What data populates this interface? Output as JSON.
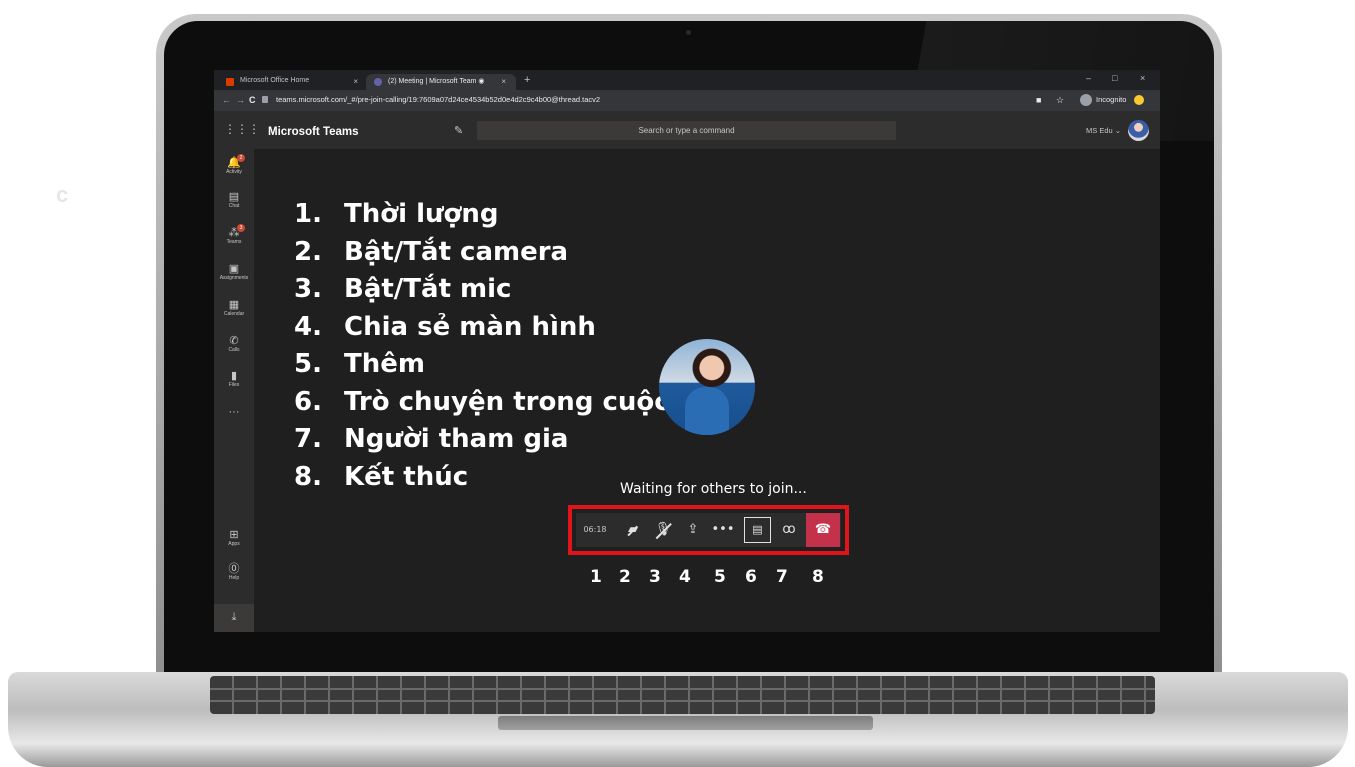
{
  "stray_letter": "c",
  "browser": {
    "tabs": [
      {
        "title": "Microsoft Office Home",
        "close": "×"
      },
      {
        "title": "(2) Meeting | Microsoft Team ◉",
        "close": "×"
      }
    ],
    "new_tab": "+",
    "window_controls": {
      "minimize": "–",
      "maximize": "□",
      "close": "×"
    },
    "nav": {
      "back": "←",
      "forward": "→",
      "reload": "C"
    },
    "url": "teams.microsoft.com/_#/pre-join-calling/19:7609a07d24ce4534b52d0e4d2c9c4b00@thread.tacv2",
    "incognito_label": "Incognito",
    "star": "☆",
    "camera_glyph": "■"
  },
  "teams": {
    "app_launcher": "⋮⋮⋮",
    "title": "Microsoft Teams",
    "compose_icon": "✎",
    "search_placeholder": "Search or type a command",
    "user_label": "MS Edu ⌄",
    "rail": [
      {
        "label": "Activity",
        "icon": "bell-icon",
        "glyph": "🔔",
        "badge": "2"
      },
      {
        "label": "Chat",
        "icon": "chat-icon",
        "glyph": "▤",
        "badge": ""
      },
      {
        "label": "Teams",
        "icon": "teams-icon",
        "glyph": "⁂",
        "badge": "3"
      },
      {
        "label": "Assignments",
        "icon": "assignments-icon",
        "glyph": "▣",
        "badge": ""
      },
      {
        "label": "Calendar",
        "icon": "calendar-icon",
        "glyph": "▦",
        "badge": ""
      },
      {
        "label": "Calls",
        "icon": "phone-icon",
        "glyph": "✆",
        "badge": ""
      },
      {
        "label": "Files",
        "icon": "files-icon",
        "glyph": "▮",
        "badge": ""
      },
      {
        "label": "",
        "icon": "more-icon",
        "glyph": "···",
        "badge": ""
      },
      {
        "label": "Apps",
        "icon": "apps-icon",
        "glyph": "⊞",
        "badge": ""
      },
      {
        "label": "Help",
        "icon": "help-icon",
        "glyph": "⓪",
        "badge": ""
      }
    ],
    "download_glyph": "⤓"
  },
  "overlay_list": [
    {
      "num": "1.",
      "text": "Thời lượng"
    },
    {
      "num": "2.",
      "text": "Bật/Tắt camera"
    },
    {
      "num": "3.",
      "text": "Bật/Tắt mic"
    },
    {
      "num": "4.",
      "text": "Chia sẻ màn hình"
    },
    {
      "num": "5.",
      "text": "Thêm"
    },
    {
      "num": "6.",
      "text": "Trò chuyện trong cuộc họp"
    },
    {
      "num": "7.",
      "text": "Người tham gia"
    },
    {
      "num": "8.",
      "text": "Kết thúc"
    }
  ],
  "meeting": {
    "waiting_text": "Waiting for others to join...",
    "timer": "06:18",
    "controls": {
      "camera_glyph": "▰",
      "mic_glyph": "🎙",
      "share_glyph": "⇪",
      "more_glyph": "•••",
      "chat_glyph": "▤",
      "people_glyph": "ꝏ",
      "hangup_glyph": "☎"
    },
    "markers": [
      "1",
      "2",
      "3",
      "4",
      "5",
      "6",
      "7",
      "8"
    ],
    "highlight_color": "#e1141c",
    "hangup_color": "#c4314b"
  }
}
